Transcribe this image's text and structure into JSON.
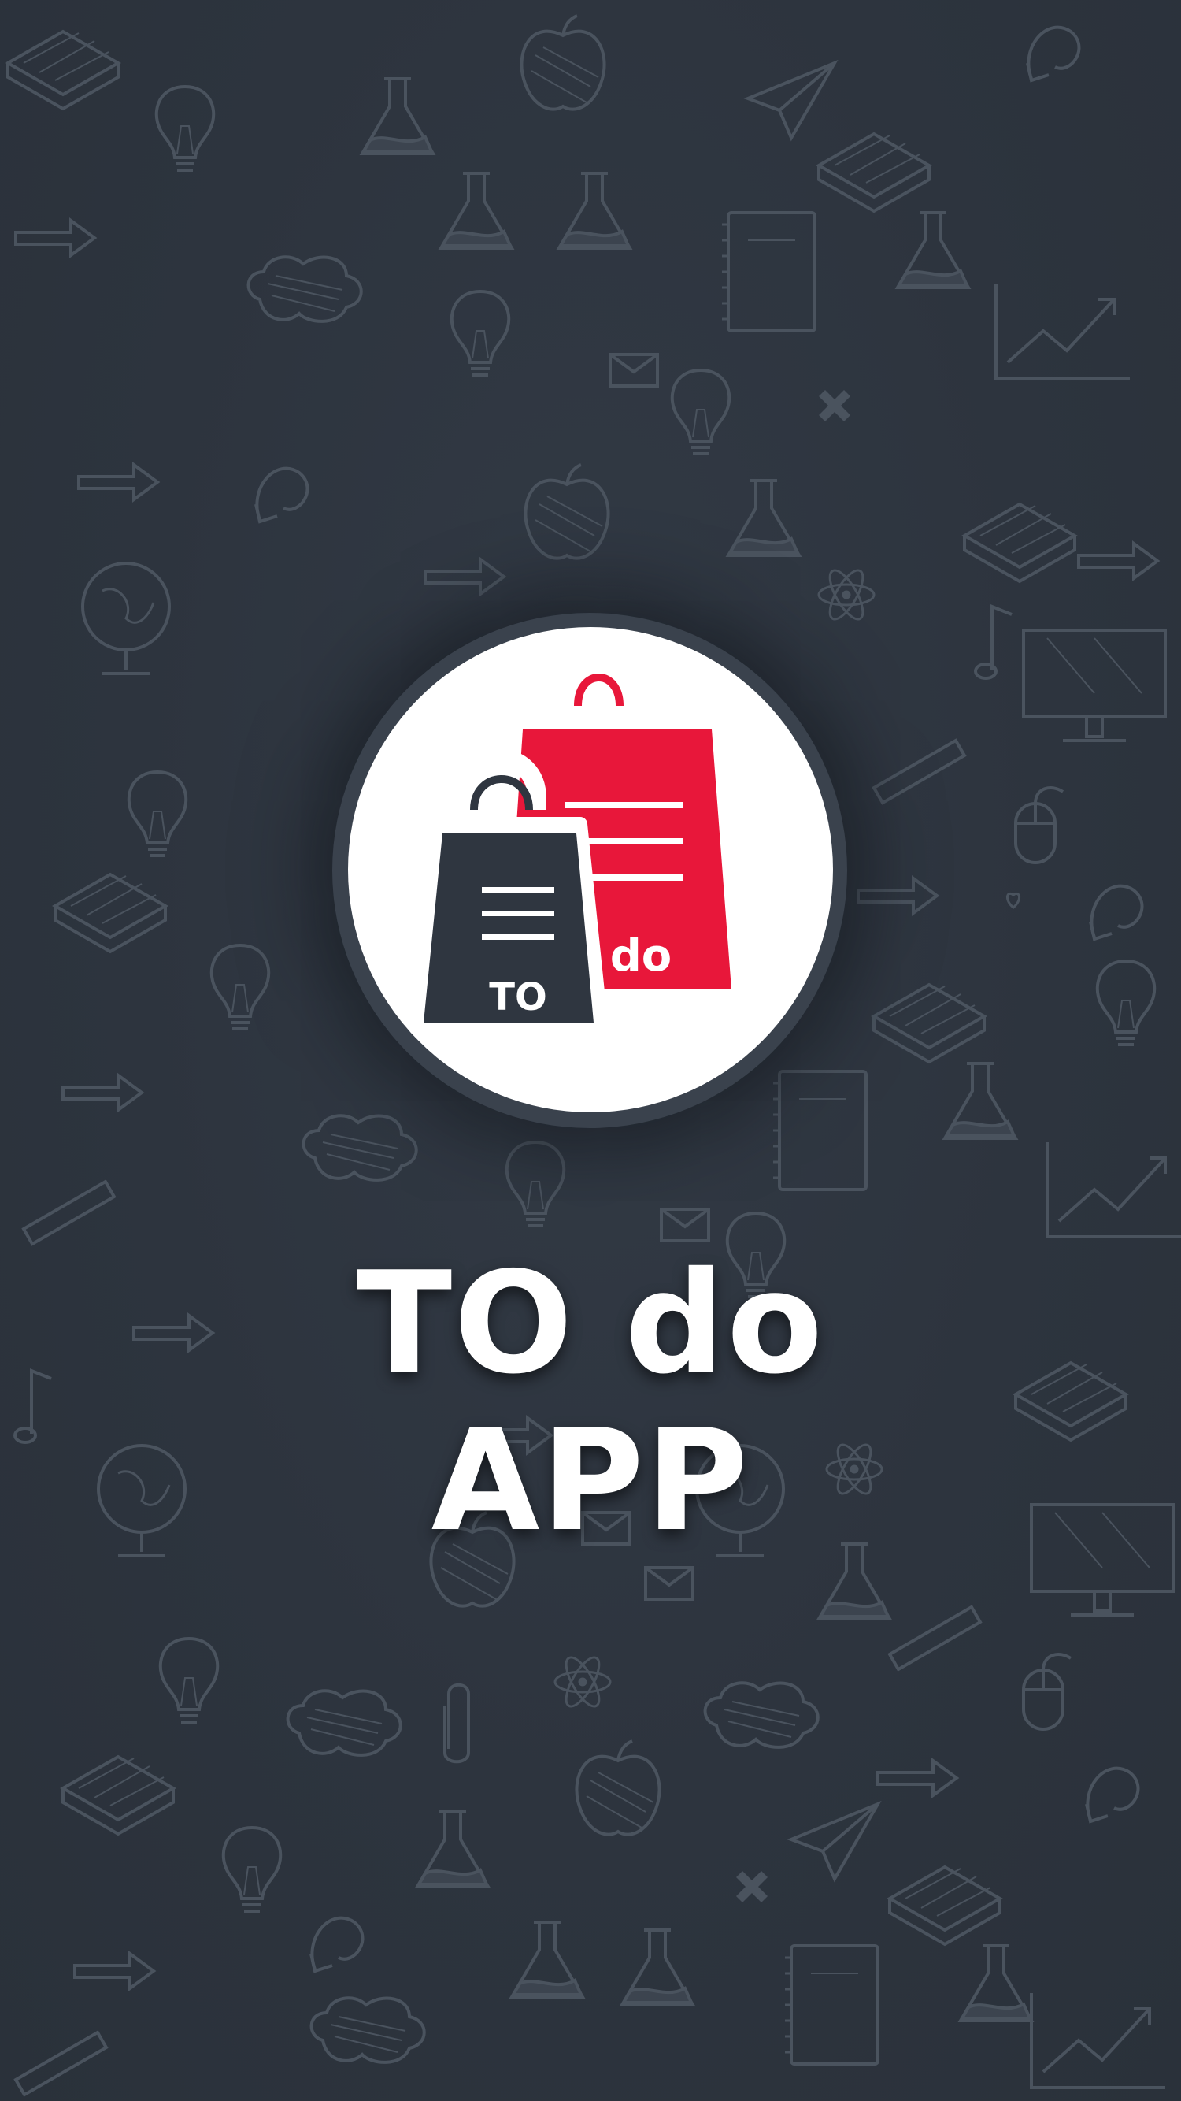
{
  "app": {
    "title": "TO do APP",
    "logo": {
      "left_bag_label": "TO",
      "right_bag_label": "do",
      "left_bag_color": "#2f3640",
      "right_bag_color": "#e8173a",
      "circle_color": "#ffffff"
    }
  },
  "theme": {
    "background": "#2f3640",
    "doodle_stroke": "#4a535e",
    "title_color": "#ffffff"
  },
  "background_doodles": [
    "book-icon",
    "apple-icon",
    "paper-plane-icon",
    "lightbulb-icon",
    "flask-icon",
    "notebook-icon",
    "globe-icon",
    "monitor-icon",
    "mouse-icon",
    "chart-arrow-icon",
    "speech-cloud-icon",
    "music-note-icon",
    "atom-icon",
    "ruler-icon",
    "envelope-icon",
    "paperclip-icon",
    "heart-icon"
  ]
}
